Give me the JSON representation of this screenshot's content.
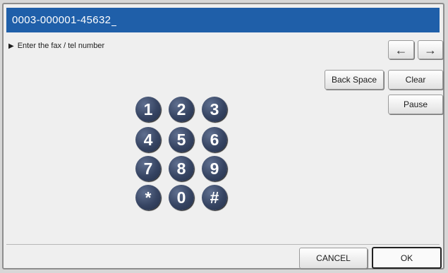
{
  "number_display": {
    "value": "0003-000001-45632"
  },
  "instruction": {
    "arrow": "▶",
    "text": "Enter the fax / tel number"
  },
  "cursor_buttons": {
    "left": "←",
    "right": "→"
  },
  "edit_buttons": {
    "back_space": "Back Space",
    "clear": "Clear",
    "pause": "Pause"
  },
  "keypad": {
    "keys": [
      "1",
      "2",
      "3",
      "4",
      "5",
      "6",
      "7",
      "8",
      "9",
      "*",
      "0",
      "#"
    ]
  },
  "footer": {
    "cancel": "CANCEL",
    "ok": "OK"
  }
}
